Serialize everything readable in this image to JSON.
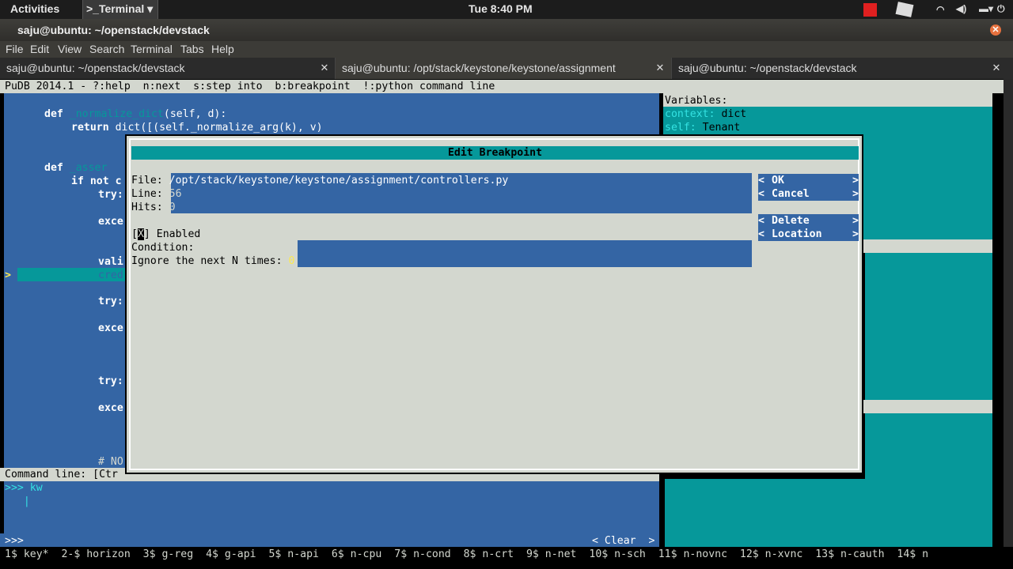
{
  "topbar": {
    "activities": "Activities",
    "app_menu": "Terminal ▾",
    "clock": "Tue   8:40 PM"
  },
  "window": {
    "title": "saju@ubuntu: ~/openstack/devstack",
    "close_glyph": "✕"
  },
  "menu": [
    "File",
    "Edit",
    "View",
    "Search",
    "Terminal",
    "Tabs",
    "Help"
  ],
  "tabs": [
    {
      "label": "saju@ubuntu: ~/openstack/devstack",
      "close": "✕"
    },
    {
      "label": "saju@ubuntu: /opt/stack/keystone/keystone/assignment",
      "close": "✕"
    },
    {
      "label": "saju@ubuntu: ~/openstack/devstack",
      "close": "✕"
    }
  ],
  "pudb": {
    "header": "PuDB 2014.1 - ?:help  n:next  s:step into  b:breakpoint  !:python command line",
    "code": {
      "def1": "def",
      "def1_name": " _normalize_dict",
      "def1_args": "(self, d):",
      "ret_kw": "return",
      "ret_rest": " dict([(self._normalize_arg(k), v)",
      "def2": "def",
      "def2_name": " _asser",
      "if_kw": "if not c",
      "try1": "try:",
      "exc1": "exce",
      "vali": "vali",
      "cred": "cred",
      "try2": "try:",
      "exc2": "exce",
      "try3": "try:",
      "exc3": "exce",
      "comment": "# NO",
      "current_marker": ">"
    },
    "variables": {
      "title": "Variables:",
      "v1_name": "context:",
      "v1_val": " dict",
      "v2_name": "self:",
      "v2_val": " Tenant"
    },
    "command_line": {
      "label": "Command line: [Ctr",
      "prompt1": ">>> kw",
      "prompt2": ">>>",
      "cursor_line": "   |",
      "clear_button": "< Clear  >"
    },
    "dialog": {
      "title": "Edit Breakpoint",
      "file_label": "File: ",
      "file_value": "/opt/stack/keystone/keystone/assignment/controllers.py",
      "line_label": "Line: ",
      "line_value": "56",
      "hits_label": "Hits: ",
      "hits_value": "0",
      "enabled_open": "[",
      "enabled_mark": "X",
      "enabled_close": "] Enabled",
      "condition_label": "Condition:",
      "ignore_label": "Ignore the next N times: ",
      "ignore_value": "0",
      "buttons": [
        "OK",
        "Cancel",
        "Delete",
        "Location"
      ],
      "btn_left": "<",
      "btn_right": ">"
    }
  },
  "screen_bar": "1$ key*  2-$ horizon  3$ g-reg  4$ g-api  5$ n-api  6$ n-cpu  7$ n-cond  8$ n-crt  9$ n-net  10$ n-sch  11$ n-novnc  12$ n-xvnc  13$ n-cauth  14$ n",
  "colors": {
    "code_bg": "#3465a4",
    "var_bg": "#06989a",
    "dialog_bg": "#d3d7cf",
    "field_bg": "#3465a4"
  }
}
